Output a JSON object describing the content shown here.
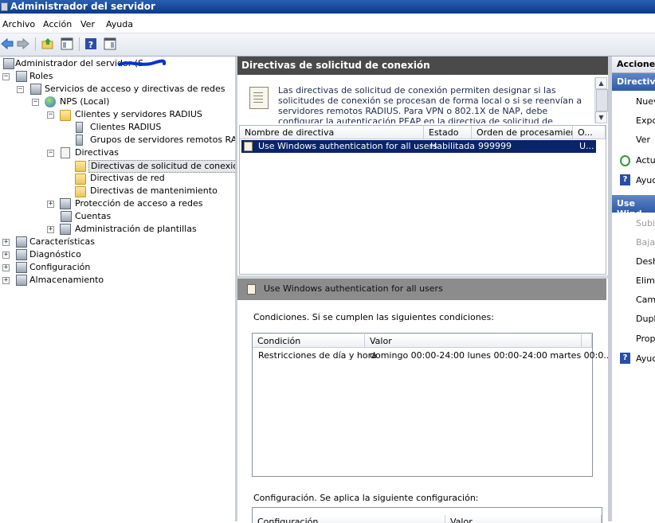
{
  "window": {
    "title": "Administrador del servidor"
  },
  "menu": [
    "Archivo",
    "Acción",
    "Ver",
    "Ayuda"
  ],
  "tree": {
    "root": "Administrador del servidor (S",
    "items": [
      "Roles",
      "Servicios de acceso y directivas de redes",
      "NPS (Local)",
      "Clientes y servidores RADIUS",
      "Clientes RADIUS",
      "Grupos de servidores remotos RADIU",
      "Directivas",
      "Directivas de solicitud de conexión",
      "Directivas de red",
      "Directivas de mantenimiento",
      "Protección de acceso a redes",
      "Cuentas",
      "Administración de plantillas",
      "Características",
      "Diagnóstico",
      "Configuración",
      "Almacenamiento"
    ]
  },
  "middle": {
    "header": "Directivas de solicitud de conexión",
    "description": "Las directivas de solicitud de conexión permiten designar si las solicitudes de conexión se procesan de forma local o si se reenvían a servidores remotos RADIUS. Para VPN o 802.1X de NAP, debe configurar la autenticación PEAP en la directiva de solicitud de conexión.",
    "columns": [
      "Nombre de directiva",
      "Estado",
      "Orden de procesamiento",
      "O..."
    ],
    "policy": {
      "name": "Use Windows authentication for all users",
      "status": "Habilitada",
      "order": "999999",
      "extra": "U..."
    },
    "detail": {
      "title": "Use Windows authentication for all users",
      "conditions_label": "Condiciones. Si se cumplen las siguientes condiciones:",
      "conditions_columns": [
        "Condición",
        "Valor"
      ],
      "condition_row": {
        "name": "Restricciones de día y hora",
        "value": "domingo 00:00-24:00 lunes 00:00-24:00 martes 00:0..."
      },
      "config_label": "Configuración. Se aplica la siguiente configuración:",
      "config_columns": [
        "Configuración",
        "Valor"
      ]
    }
  },
  "actions": {
    "header": "Acciones",
    "section1": "Directiva",
    "items1": [
      "Nueva",
      "Expo",
      "Ver",
      "Actua",
      "Ayuc"
    ],
    "section2": "Use Wind",
    "items2": [
      "Subir",
      "Bajar",
      "Desh",
      "Elimi",
      "Camb",
      "Dupli",
      "Propi",
      "Ayuc"
    ]
  }
}
